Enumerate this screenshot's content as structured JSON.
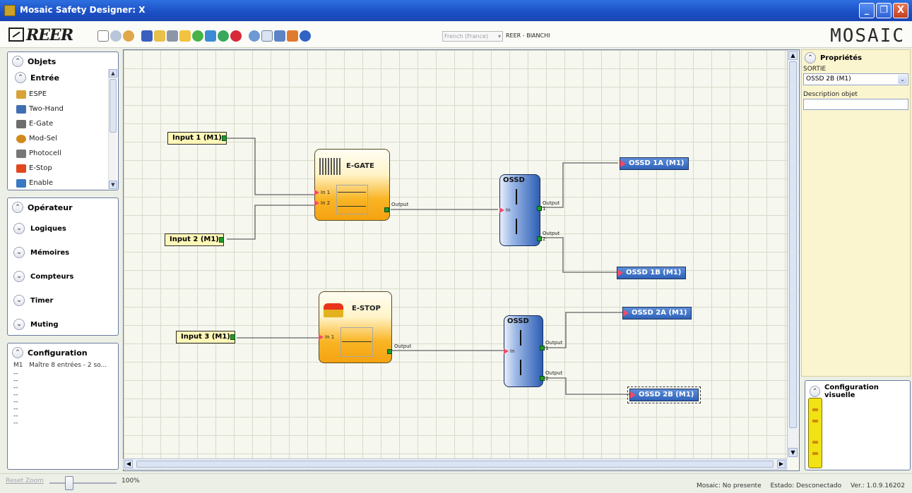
{
  "window": {
    "title": "Mosaic Safety Designer: X",
    "min": "_",
    "max": "❐",
    "close": "X"
  },
  "toolbar": {
    "brand_left": "REER",
    "language": "French (France)",
    "user": "REER - BIANCHI",
    "brand_right": "MOSAIC",
    "icons": [
      "new-icon",
      "open-icon",
      "user-icon",
      "save-icon",
      "folder-icon",
      "print-icon",
      "edit-icon",
      "validate-icon",
      "transfer-icon",
      "refresh-icon",
      "stop-icon",
      "zoom-icon",
      "report-icon",
      "monitor-icon",
      "tools-icon",
      "help-icon"
    ]
  },
  "objets": {
    "title": "Objets",
    "entree_title": "Entrée",
    "items": [
      {
        "label": "ESPE",
        "color": "#d6a33a"
      },
      {
        "label": "Two-Hand",
        "color": "#3f6fb2"
      },
      {
        "label": "E-Gate",
        "color": "#6d6d6d"
      },
      {
        "label": "Mod-Sel",
        "color": "#d28b1a"
      },
      {
        "label": "Photocell",
        "color": "#777777"
      },
      {
        "label": "E-Stop",
        "color": "#e2461f"
      },
      {
        "label": "Enable",
        "color": "#3878c4"
      }
    ]
  },
  "operateur": {
    "title": "Opérateur",
    "items": [
      "Logiques",
      "Mémoires",
      "Compteurs",
      "Timer",
      "Muting"
    ]
  },
  "configuration": {
    "title": "Configuration",
    "m1_id": "M1",
    "m1_desc": "Maître 8 entrées - 2 so...",
    "placeholders": [
      "--",
      "--",
      "--",
      "--",
      "--",
      "--",
      "--",
      "--"
    ]
  },
  "diagram": {
    "inputs": [
      "Input 1 (M1)",
      "Input 2 (M1)",
      "Input 3 (M1)"
    ],
    "egate": {
      "title": "E-GATE",
      "in1": "In 1",
      "in2": "In 2",
      "out": "Output"
    },
    "estop": {
      "title": "E-STOP",
      "in1": "In 1",
      "out": "Output"
    },
    "ossd1": {
      "title": "OSSD",
      "in": "In",
      "out1": "Output 1",
      "out2": "Output 2"
    },
    "ossd2": {
      "title": "OSSD",
      "in": "In",
      "out1": "Output 1",
      "out2": "Output 2"
    },
    "outputs": [
      "OSSD 1A (M1)",
      "OSSD 1B (M1)",
      "OSSD 2A (M1)",
      "OSSD 2B (M1)"
    ]
  },
  "properties": {
    "title": "Propriétés",
    "sortie_label": "SORTIE",
    "sortie_value": "OSSD 2B (M1)",
    "desc_label": "Description objet",
    "visual_title": "Configuration visuelle"
  },
  "status": {
    "reset_zoom": "Reset Zoom",
    "zoom": "100%",
    "mosaic": "Mosaic: No presente",
    "estado": "Estado: Desconectado",
    "version": "Ver.: 1.0.9.16202"
  }
}
